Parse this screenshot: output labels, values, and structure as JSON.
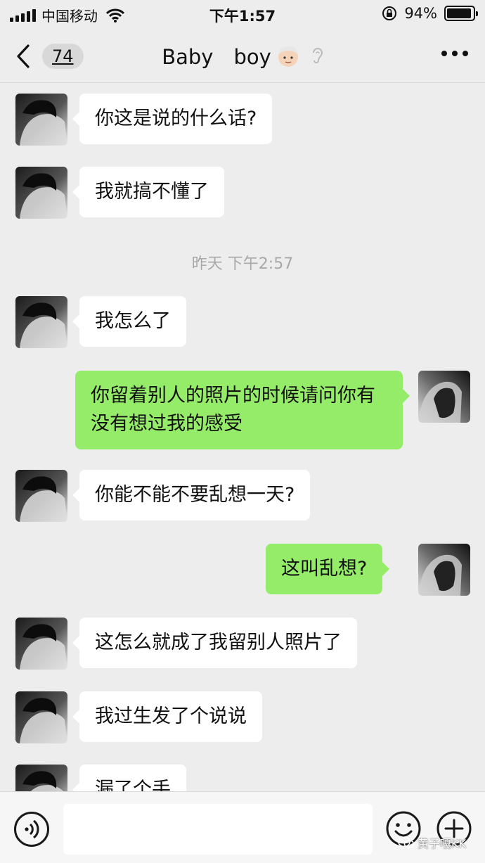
{
  "status_bar": {
    "carrier": "中国移动",
    "time": "下午1:57",
    "battery_percent": "94%",
    "battery_level": 0.94
  },
  "nav": {
    "unread_count": "74",
    "title": "Baby　boy",
    "icons": [
      "chevron-left-icon",
      "boy-face-icon",
      "ear-icon",
      "more-icon"
    ]
  },
  "messages": [
    {
      "side": "in",
      "text": "你这是说的什么话?"
    },
    {
      "side": "in",
      "text": "我就搞不懂了"
    },
    {
      "type": "time",
      "text": "昨天 下午2:57"
    },
    {
      "side": "in",
      "text": "我怎么了"
    },
    {
      "side": "out",
      "text": "你留着别人的照片的时候请问你有没有想过我的感受"
    },
    {
      "side": "in",
      "text": "你能不能不要乱想一天?"
    },
    {
      "side": "out",
      "text": "这叫乱想?"
    },
    {
      "side": "in",
      "text": "这怎么就成了我留别人照片了"
    },
    {
      "side": "in",
      "text": "我过生发了个说说"
    },
    {
      "side": "in",
      "text": "漏了个手"
    }
  ],
  "input_bar": {
    "icons": [
      "voice-icon",
      "emoji-icon",
      "plus-icon"
    ]
  },
  "watermark": "黄子嘎KK",
  "colors": {
    "background": "#ededed",
    "outgoing_bubble": "#95ec69",
    "incoming_bubble": "#ffffff"
  }
}
